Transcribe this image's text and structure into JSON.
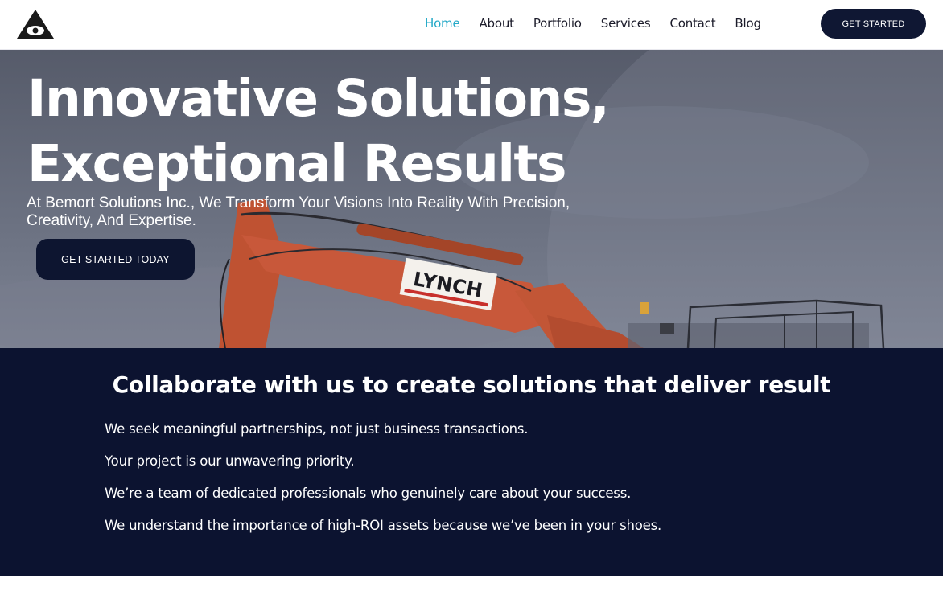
{
  "header": {
    "logo_icon": "triangle-eye-logo-icon",
    "nav": [
      {
        "label": "Home",
        "active": true
      },
      {
        "label": "About",
        "active": false
      },
      {
        "label": "Portfolio",
        "active": false
      },
      {
        "label": "Services",
        "active": false
      },
      {
        "label": "Contact",
        "active": false
      },
      {
        "label": "Blog",
        "active": false
      }
    ],
    "cta_label": "GET STARTED"
  },
  "hero": {
    "title_line1": "Innovative Solutions,",
    "title_line2": "Exceptional Results",
    "subtitle": "At Bemort Solutions Inc., We Transform Your Visions Into Reality With Precision, Creativity, And Expertise.",
    "cta_label": "GET STARTED TODAY",
    "image_sign_text": "LYNCH"
  },
  "collab": {
    "title": "Collaborate with us to create solutions that deliver result",
    "points": [
      "We seek meaningful partnerships, not just business transactions.",
      "Your project is our unwavering priority.",
      "We’re a team of dedicated professionals who genuinely care about your success.",
      "We understand the importance of high-ROI assets because we’ve been in your shoes."
    ]
  },
  "colors": {
    "accent": "#22a8c7",
    "navy": "#0c1330",
    "excavator_orange": "#c8583a"
  }
}
